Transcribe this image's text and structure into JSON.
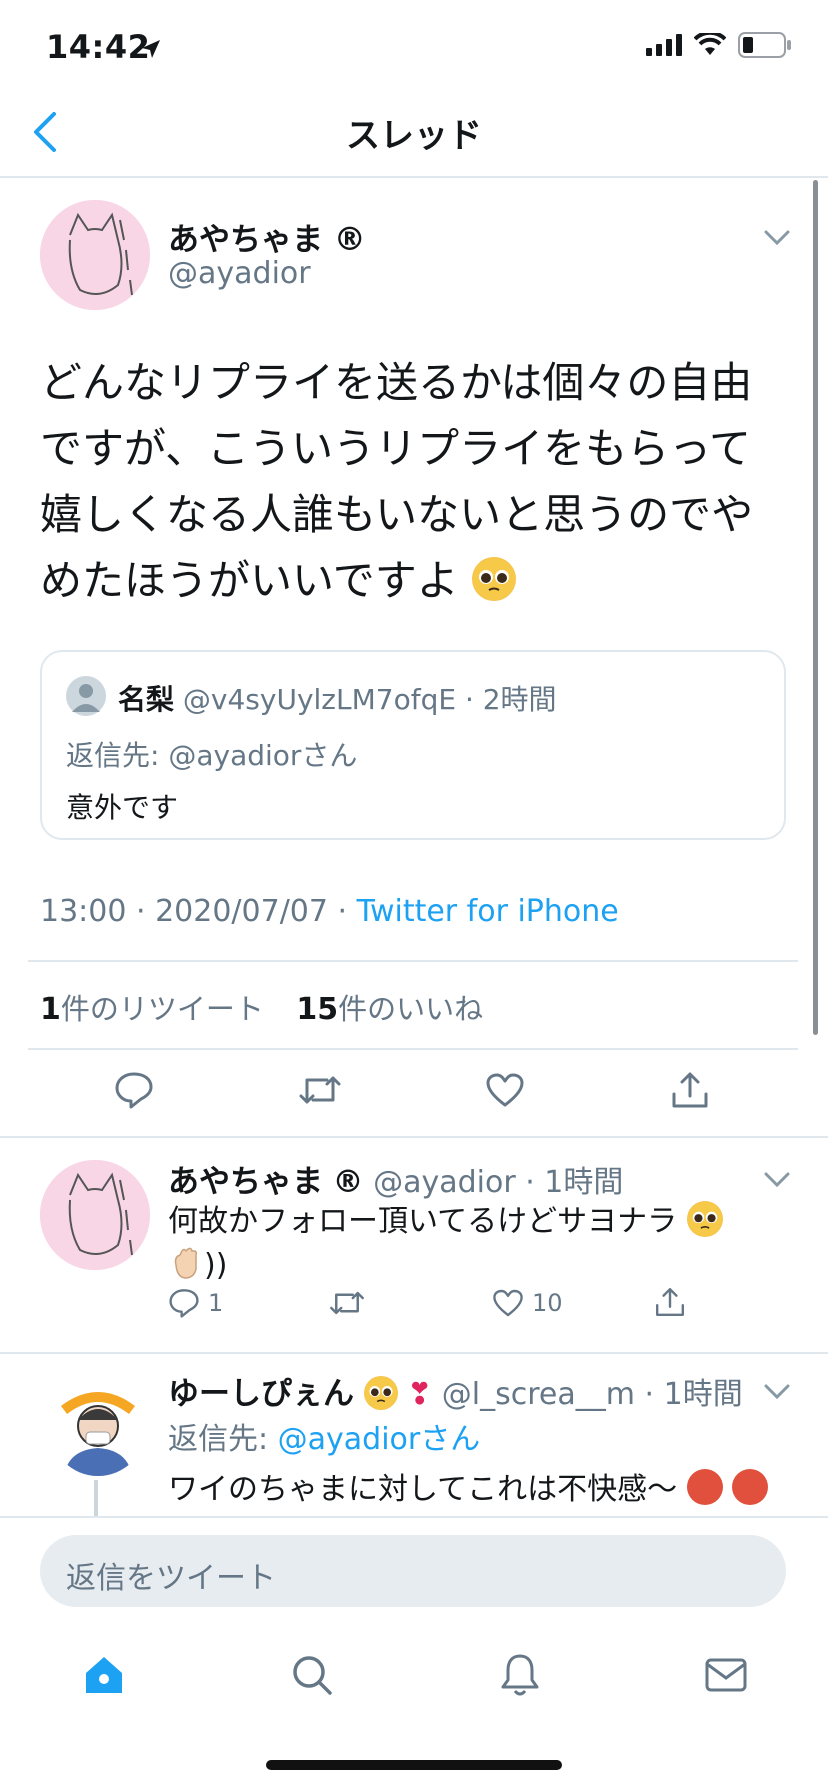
{
  "status_bar": {
    "time": "14:42"
  },
  "nav": {
    "title": "スレッド"
  },
  "main_tweet": {
    "name": "あやちゃま",
    "name_mark": "®",
    "handle": "@ayadior",
    "text": "どんなリプライを送るかは個々の自由ですが、こういうリプライをもらって嬉しくなる人誰もいないと思うのでやめたほうがいいですよ",
    "quote": {
      "name": "名梨",
      "handle": "@v4syUylzLM7ofqE",
      "time": "· 2時間",
      "reply_to_prefix": "返信先:",
      "reply_to_handle": "@ayadiorさん",
      "text": "意外です"
    },
    "timestamp": "13:00 · 2020/07/07 ·",
    "source": "Twitter for iPhone",
    "retweet_count": "1",
    "retweet_label": "件のリツイート",
    "like_count": "15",
    "like_label": "件のいいね"
  },
  "replies": [
    {
      "name": "あやちゃま",
      "name_mark": "®",
      "handle": "@ayadior",
      "time": "· 1時間",
      "text_line1": "何故かフォロー頂いてるけどサヨナラ",
      "text_line2": "))",
      "reply_count": "1",
      "like_count": "10"
    },
    {
      "name": "ゆーしぴぇん",
      "name_heart": "❣",
      "handle": "@l_screa__m",
      "time": "· 1時間",
      "reply_to_prefix": "返信先:",
      "reply_to_handle": "@ayadiorさん",
      "text": "ワイのちゃまに対してこれは不快感〜"
    }
  ],
  "compose": {
    "placeholder": "返信をツイート"
  },
  "icons": {
    "back": "chevron-left-icon",
    "caret": "chevron-down-icon",
    "reply": "reply-bubble-icon",
    "retweet": "retweet-icon",
    "like": "heart-icon",
    "share": "share-icon",
    "home": "home-icon",
    "search": "search-icon",
    "notifications": "bell-icon",
    "messages": "mail-icon"
  },
  "colors": {
    "accent": "#1da1f2",
    "muted": "#657786",
    "divider": "#e1e8ed"
  }
}
